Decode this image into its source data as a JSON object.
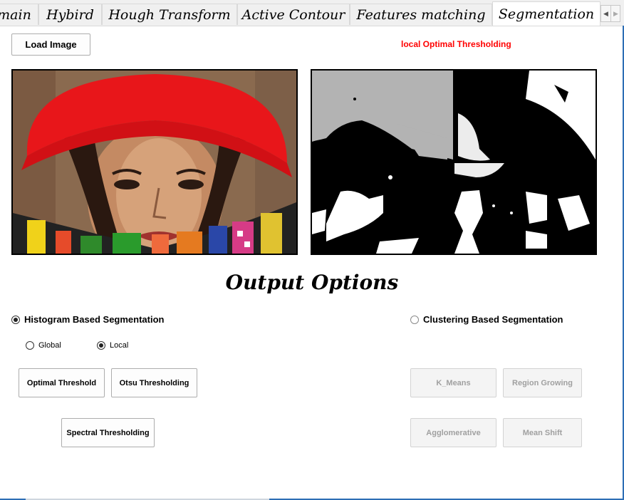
{
  "tabs": [
    {
      "label": "main",
      "active": false
    },
    {
      "label": "Hybird",
      "active": false
    },
    {
      "label": "Hough Transform",
      "active": false
    },
    {
      "label": "Active Contour",
      "active": false
    },
    {
      "label": "Features matching",
      "active": false
    },
    {
      "label": "Segmentation",
      "active": true
    }
  ],
  "toolbar": {
    "load_image_label": "Load Image",
    "status_text": "local Optimal Thresholding",
    "status_color": "#ff0000"
  },
  "images": {
    "input_description_icon": "portrait-photo",
    "output_description_icon": "binary-segmented-photo"
  },
  "output_options": {
    "title": "Output Options",
    "histogram": {
      "label": "Histogram Based Segmentation",
      "selected": true,
      "scope_global": "Global",
      "scope_local": "Local",
      "scope_selected": "Local",
      "buttons": {
        "optimal": "Optimal Threshold",
        "otsu": "Otsu Thresholding",
        "spectral": "Spectral Thresholding"
      }
    },
    "clustering": {
      "label": "Clustering Based Segmentation",
      "selected": false,
      "buttons": {
        "kmeans": "K_Means",
        "region_growing": "Region Growing",
        "agglomerative": "Agglomerative",
        "mean_shift": "Mean Shift"
      }
    }
  }
}
